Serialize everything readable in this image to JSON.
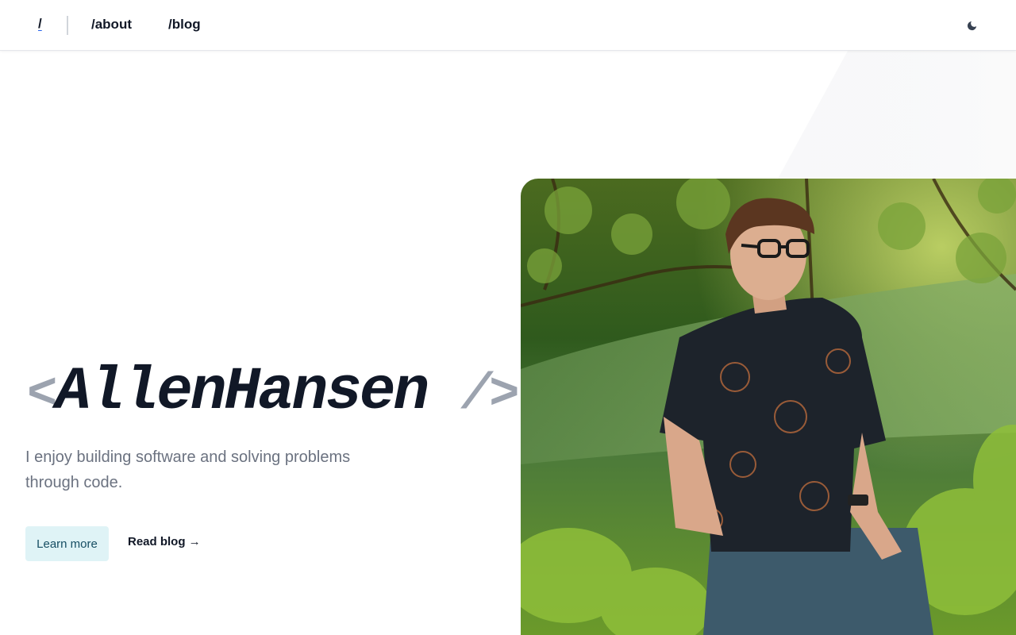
{
  "nav": {
    "home": "/",
    "about": "/about",
    "blog": "/blog",
    "theme_toggle_icon": "moon-icon"
  },
  "hero": {
    "open_bracket": "<",
    "name": "AllenHansen",
    "close_bracket": "/>",
    "tagline": "I enjoy building software and solving problems through code.",
    "primary_button": "Learn more",
    "secondary_link": "Read blog →"
  },
  "photo": {
    "subject": "portrait-photo"
  },
  "colors": {
    "accent_button_bg": "#dff3f6",
    "accent_button_text": "#164e63",
    "underline_accent": "#2563eb",
    "muted_text": "#6b7280",
    "bracket_gray": "#9ca3af"
  }
}
